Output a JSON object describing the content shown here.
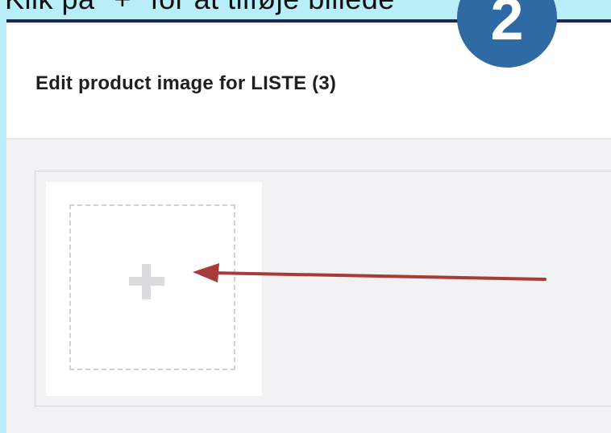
{
  "instruction_banner": {
    "text": "Klik på \"+\" for at tilføje billede"
  },
  "step_badge": {
    "number": "2",
    "color": "#2f6aa5"
  },
  "modal": {
    "title": "Edit product image for LISTE (3)"
  },
  "image_upload": {
    "add_icon": "plus-icon"
  },
  "annotation": {
    "arrow_icon": "arrow-left-icon",
    "arrow_color": "#a83a3a"
  },
  "colors": {
    "banner_bg": "#b8eef8",
    "header_line": "#1b2a4e",
    "panel_bg": "#f2f1f3"
  }
}
